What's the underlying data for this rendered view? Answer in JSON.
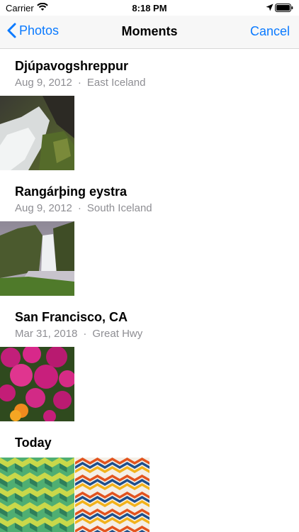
{
  "status_bar": {
    "carrier": "Carrier",
    "time": "8:18 PM"
  },
  "nav": {
    "back_label": "Photos",
    "title": "Moments",
    "cancel_label": "Cancel",
    "accent_color": "#0a7aff"
  },
  "moments": [
    {
      "title": "Djúpavogshreppur",
      "date": "Aug 9, 2012",
      "separator": "·",
      "location": "East Iceland",
      "photos": [
        "waterfall-rocks-photo"
      ]
    },
    {
      "title": "Rangárþing eystra",
      "date": "Aug 9, 2012",
      "separator": "·",
      "location": "South Iceland",
      "photos": [
        "waterfall-cliff-photo"
      ]
    },
    {
      "title": "San Francisco, CA",
      "date": "Mar 31, 2018",
      "separator": "·",
      "location": "Great Hwy",
      "photos": [
        "flowers-photo"
      ]
    },
    {
      "title": "Today",
      "photos": [
        "green-pattern-photo",
        "chevron-pattern-photo"
      ]
    }
  ]
}
